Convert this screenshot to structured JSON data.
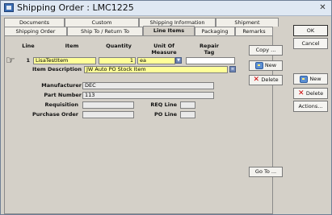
{
  "window": {
    "title": "Shipping Order : LMC1225",
    "close_glyph": "✕"
  },
  "tabs_row1": [
    "Documents",
    "Custom",
    "Shipping Information",
    "Shipment"
  ],
  "tabs_row2": [
    "Shipping Order",
    "Ship To / Return To",
    "Line Items",
    "Packaging",
    "Remarks"
  ],
  "active_tab": "Line Items",
  "columns": {
    "line": "Line",
    "item": "Item",
    "quantity": "Quantity",
    "unit_of_measure_1": "Unit Of",
    "unit_of_measure_2": "Measure",
    "repair_tag_1": "Repair",
    "repair_tag_2": "Tag"
  },
  "line_item": {
    "line_number": "1",
    "item": "LisaTestItem",
    "quantity": "1",
    "unit_of_measure": "ea",
    "repair_tag": "",
    "item_description_label": "Item Description",
    "item_description": "JW Auto PO Stock Item"
  },
  "details": {
    "manufacturer_label": "Manufacturer",
    "manufacturer": "DEC",
    "part_number_label": "Part Number",
    "part_number": "113",
    "requisition_label": "Requisition",
    "requisition": "",
    "purchase_order_label": "Purchase Order",
    "purchase_order": "",
    "req_line_label": "REQ Line",
    "req_line": "",
    "po_line_label": "PO  Line",
    "po_line": ""
  },
  "line_buttons": {
    "copy": "Copy ...",
    "new": "New",
    "delete": "Delete",
    "goto": "Go To ..."
  },
  "right_buttons": {
    "ok": "OK",
    "cancel": "Cancel",
    "new": "New",
    "delete": "Delete",
    "actions": "Actions..."
  },
  "icons": {
    "pointer": "pointing-hand-icon",
    "uom_dropdown": "chevron-down-icon",
    "description_picker": "list-picker-icon",
    "new": "new-record-icon",
    "delete": "delete-x-icon"
  },
  "colors": {
    "required_field": "#ffff99",
    "dialog_background": "#d4d0c8"
  }
}
